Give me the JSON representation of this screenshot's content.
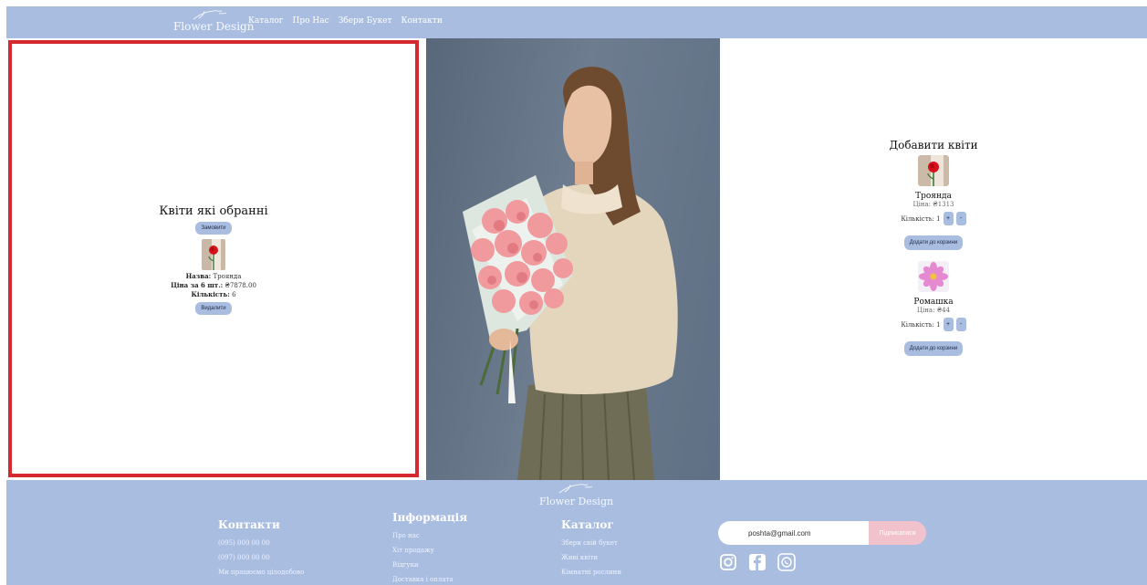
{
  "header": {
    "logo_text": "Flower Design",
    "nav": [
      "Каталог",
      "Про Нас",
      "Збери Букет",
      "Контакти"
    ]
  },
  "selected": {
    "title": "Квіти які обранні",
    "order_label": "Замовити",
    "item": {
      "name_label": "Назва:",
      "name": "Троянда",
      "price_label": "Ціна за 6 шт.:",
      "price": "₴7878.00",
      "qty_label": "Кількість:",
      "qty": "6"
    },
    "delete_label": "Видалити"
  },
  "add": {
    "title": "Добавити квіти",
    "products": [
      {
        "name": "Троянда",
        "price": "Ціна: ₴1313",
        "qty_label": "Кількість:",
        "qty": "1",
        "plus": "+",
        "minus": "-",
        "cart_label": "Додати до корзини",
        "icon": "rose"
      },
      {
        "name": "Ромашка",
        "price": "Ціна: ₴44",
        "qty_label": "Кількість:",
        "qty": "1",
        "plus": "+",
        "minus": "-",
        "cart_label": "Додати до корзини",
        "icon": "cosmos"
      }
    ]
  },
  "footer": {
    "logo_text": "Flower Design",
    "contacts": {
      "title": "Контакти",
      "lines": [
        "(095) 000 00 00",
        "(097) 000 00 00",
        "Ми працюємо цілодобово"
      ]
    },
    "info": {
      "title": "Інформація",
      "links": [
        "Про нас",
        "Хіт продажу",
        "Відгуки",
        "Доставка і оплата"
      ]
    },
    "catalog": {
      "title": "Каталог",
      "links": [
        "Збери свій букет",
        "Живі квіти",
        "Кімнатні рослини"
      ]
    },
    "subscribe": {
      "value": "poshta@gmail.com",
      "button": "Підписатися"
    },
    "socials": [
      "instagram-icon",
      "facebook-icon",
      "whatsapp-icon"
    ]
  },
  "colors": {
    "accent": "#a9bde0",
    "highlight_border": "#d42a2f",
    "subscribe_button": "#f2c2cc"
  }
}
